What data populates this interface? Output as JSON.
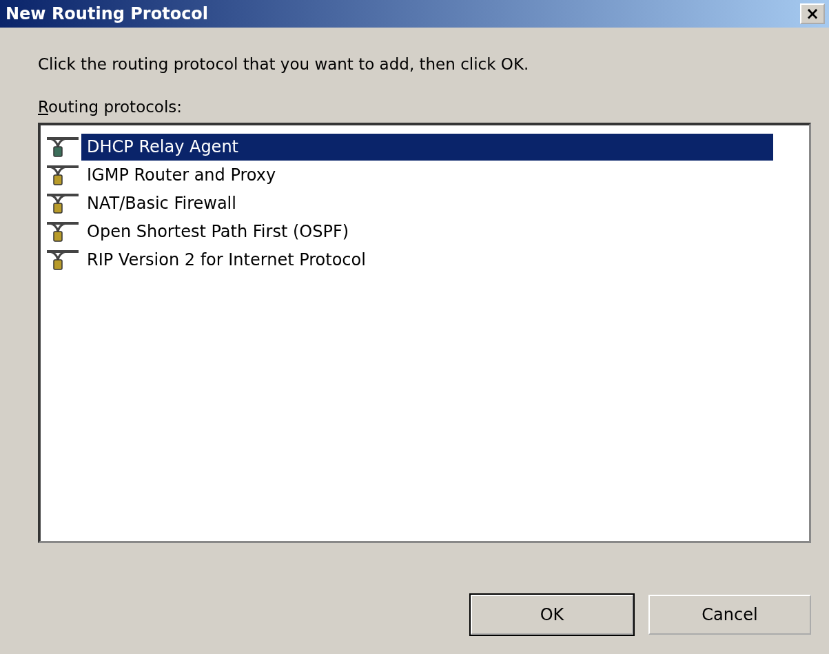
{
  "window": {
    "title": "New Routing Protocol",
    "close_label": "×"
  },
  "instruction": "Click the routing protocol that you want to add, then click OK.",
  "list_label": {
    "text": "Routing protocols:",
    "mnemonic_underlined": true
  },
  "protocols": [
    {
      "name": "DHCP Relay Agent",
      "selected": true
    },
    {
      "name": "IGMP Router and Proxy",
      "selected": false
    },
    {
      "name": "NAT/Basic Firewall",
      "selected": false
    },
    {
      "name": "Open Shortest Path First (OSPF)",
      "selected": false
    },
    {
      "name": "RIP Version 2 for Internet Protocol",
      "selected": false
    }
  ],
  "buttons": [
    {
      "label": "OK",
      "default": true
    },
    {
      "label": "Cancel",
      "default": false
    }
  ]
}
